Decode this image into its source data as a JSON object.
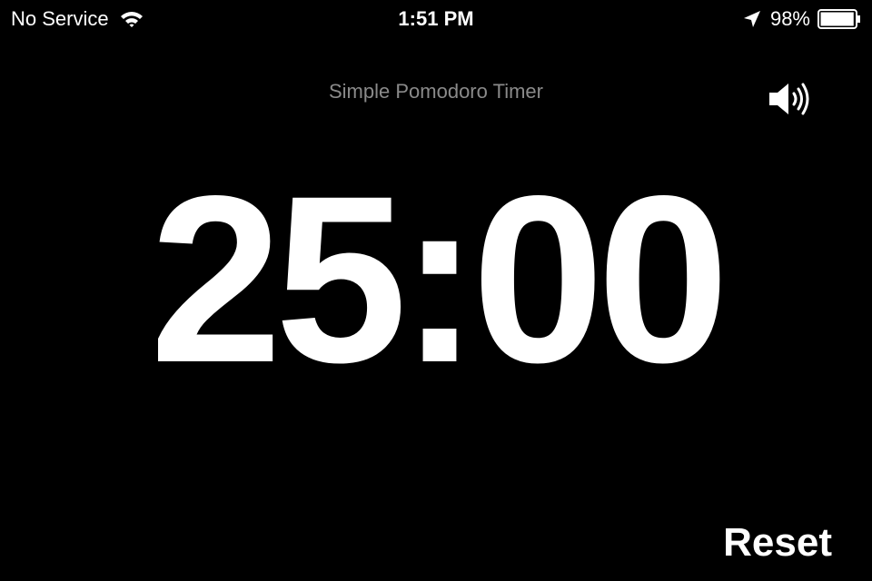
{
  "status_bar": {
    "carrier": "No Service",
    "time": "1:51 PM",
    "battery_percent": "98%",
    "battery_level": 0.98,
    "icons": [
      "wifi-icon",
      "location-arrow-icon",
      "battery-icon"
    ]
  },
  "app": {
    "title": "Simple Pomodoro Timer",
    "sound_icon": "speaker-icon"
  },
  "timer": {
    "display": "25:00"
  },
  "controls": {
    "reset_label": "Reset"
  },
  "colors": {
    "background": "#000000",
    "text": "#ffffff",
    "title_text": "#8a8a8a"
  }
}
